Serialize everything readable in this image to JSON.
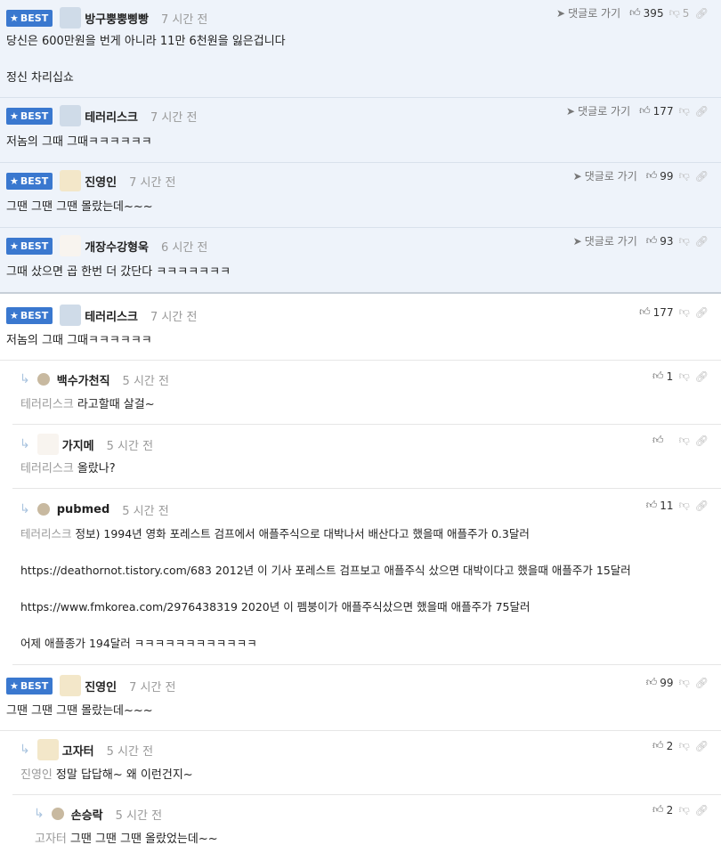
{
  "best_badge": "BEST",
  "goto_label": "댓글로 가기",
  "best": [
    {
      "nick": "방구뿡뿡삥빵",
      "time": "7 시간 전",
      "up": "395",
      "down": "5",
      "lines": [
        "당신은 600만원을 번게 아니라 11만 6천원을 잃은겁니다",
        "",
        "정신 차리십쇼"
      ]
    },
    {
      "nick": "테러리스크",
      "time": "7 시간 전",
      "up": "177",
      "down": "",
      "lines": [
        "저놈의 그때 그때ㅋㅋㅋㅋㅋㅋ"
      ]
    },
    {
      "nick": "진영인",
      "time": "7 시간 전",
      "up": "99",
      "down": "",
      "lines": [
        "그땐 그땐 그땐 몰랐는데~~~"
      ]
    },
    {
      "nick": "개장수강형욱",
      "time": "6 시간 전",
      "up": "93",
      "down": "",
      "lines": [
        "그때 샀으면 곱 한번 더 갔단다 ㅋㅋㅋㅋㅋㅋㅋ"
      ]
    }
  ],
  "thread1": {
    "root": {
      "nick": "테러리스크",
      "time": "7 시간 전",
      "up": "177",
      "text": "저놈의 그때 그때ㅋㅋㅋㅋㅋㅋ"
    },
    "replies": [
      {
        "nick": "백수가천직",
        "time": "5 시간 전",
        "up": "1",
        "mention": "테러리스크",
        "lines": [
          "라고할때 살걸~"
        ]
      },
      {
        "nick": "가지메",
        "time": "5 시간 전",
        "up": "",
        "mention": "테러리스크",
        "lines": [
          "올랐나?"
        ]
      },
      {
        "nick": "pubmed",
        "time": "5 시간 전",
        "up": "11",
        "mention": "테러리스크",
        "lines": [
          "정보) 1994년 영화 포레스트 검프에서 애플주식으로 대박나서 배산다고 했을때 애플주가 0.3달러",
          "",
          "https://deathornot.tistory.com/683 2012년 이 기사 포레스트 검프보고 애플주식 샀으면 대박이다고 했을때 애플주가 15달러",
          "",
          "https://www.fmkorea.com/2976438319 2020년 이 펨붕이가 애플주식샀으면 했을때 애플주가 75달러",
          "",
          "어제 애플종가 194달러 ㅋㅋㅋㅋㅋㅋㅋㅋㅋㅋㅋㅋ"
        ]
      }
    ]
  },
  "thread2": {
    "root": {
      "nick": "진영인",
      "time": "7 시간 전",
      "up": "99",
      "text": "그땐 그땐 그땐 몰랐는데~~~"
    },
    "replies": [
      {
        "nick": "고자터",
        "time": "5 시간 전",
        "up": "2",
        "mention": "진영인",
        "lines": [
          "정말 답답해~ 왜 이런건지~"
        ]
      },
      {
        "nick": "손승락",
        "time": "5 시간 전",
        "up": "2",
        "mention": "고자터",
        "lines": [
          "그땐 그땐 그땐 올랐었는데~~"
        ]
      }
    ]
  },
  "colors": {
    "accent": "#3a78cf",
    "best_bg": "#eef3fa"
  },
  "icons": {
    "thumb_up": "thumbs-up-icon",
    "thumb_down": "thumbs-down-icon",
    "link": "link-icon",
    "star": "star-icon",
    "reply": "reply-arrow-icon",
    "goto": "arrow-icon"
  }
}
